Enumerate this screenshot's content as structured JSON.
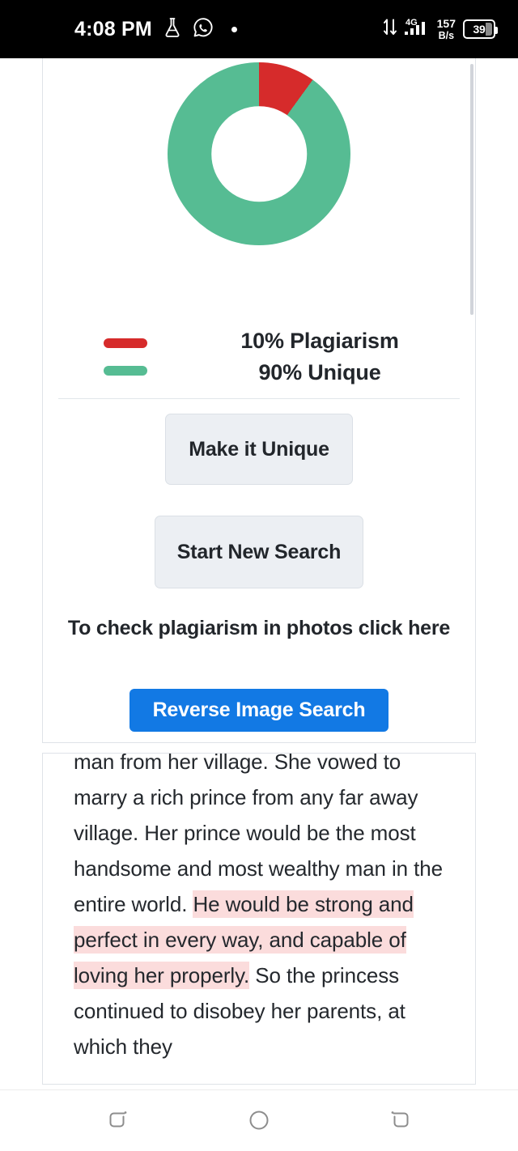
{
  "status_bar": {
    "time": "4:08 PM",
    "icons": [
      "flask-icon",
      "whatsapp-icon",
      "dot-indicator"
    ],
    "network_speed_value": "157",
    "network_speed_unit": "B/s",
    "network_type": "4G",
    "battery_level": "39"
  },
  "result_card": {
    "chart_data": {
      "type": "pie",
      "variant": "donut",
      "title": "",
      "categories": [
        "Plagiarism",
        "Unique"
      ],
      "values": [
        10,
        90
      ],
      "labels": [
        "10% Plagiarism",
        "90% Unique"
      ],
      "colors": [
        "#d62b2b",
        "#56bc93"
      ],
      "units": "percent",
      "legend_position": "below",
      "inner_radius_ratio": 0.52,
      "start_angle": 0,
      "series": [
        {
          "name": "Plagiarism",
          "value": 10,
          "color": "#d62b2b",
          "label": "10% Plagiarism"
        },
        {
          "name": "Unique",
          "value": 90,
          "color": "#56bc93",
          "label": "90% Unique"
        }
      ]
    },
    "legend": [
      {
        "label": "10% Plagiarism",
        "color": "#d62b2b"
      },
      {
        "label": "90% Unique",
        "color": "#56bc93"
      }
    ],
    "make_unique_label": "Make it Unique",
    "start_new_search_label": "Start New Search",
    "promo_text": "To check plagiarism in photos click here",
    "reverse_image_search_label": "Reverse Image Search",
    "accent_blue": "#1279e4"
  },
  "text_card": {
    "clipped_top_line": "man from her village. She vowed to",
    "line_2": "marry a rich prince from any far",
    "line_3": "away village. Her prince would be",
    "line_4": "the most handsome and most",
    "line_5_pre": "wealthy man in the entire world. ",
    "highlighted_text": "He would be strong and perfect in every way, and capable of loving her properly.",
    "line_after_highlight": " So the princess continued",
    "line_last": "to disobey her parents, at which they",
    "highlight_color": "#fbdcdc"
  },
  "nav_bar": {
    "recents_label": "recent-apps",
    "home_label": "home",
    "back_label": "back"
  }
}
